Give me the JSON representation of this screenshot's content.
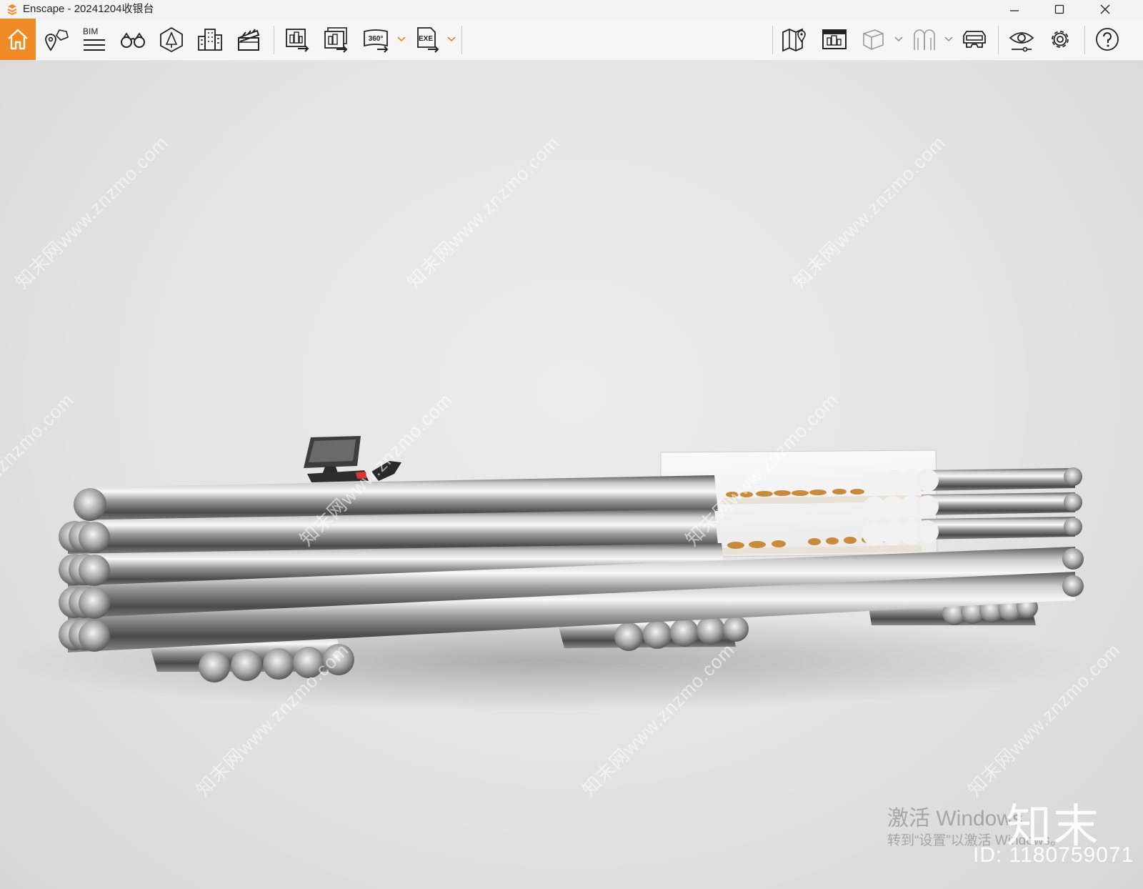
{
  "window": {
    "title": "Enscape - 20241204收银台",
    "controls": [
      "minimize",
      "maximize",
      "close"
    ]
  },
  "toolbar": {
    "accent_color": "#f08a24",
    "bim_label": "BIM",
    "left_items": [
      "home-icon",
      "views-icon",
      "bim-icon",
      "binoculars-icon",
      "asset-library-icon",
      "buildings-icon",
      "video-editor-icon"
    ],
    "export_items": [
      "render-image-icon",
      "batch-render-icon",
      "panorama-360-icon",
      "export-exe-icon"
    ],
    "panorama_label": "360°",
    "exe_label": "EXE",
    "right_items": [
      "map-icon",
      "site-context-icon",
      "cube-icon",
      "ghost-icon",
      "vr-headset-icon",
      "visual-settings-icon",
      "settings-icon",
      "help-icon"
    ]
  },
  "viewport": {
    "collapse_icon": "chevron-up-icon",
    "watermark_text": "知末网www.znzmo.com",
    "windows_activation": {
      "line1": "激活 Windows",
      "line2": "转到“设置”以激活 Windows。"
    },
    "brand": "知末",
    "id_label": "ID: 1180759071"
  }
}
